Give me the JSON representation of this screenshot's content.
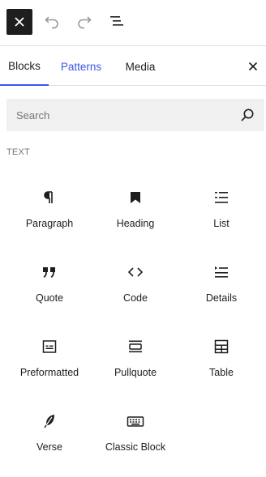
{
  "toolbar": {
    "close_icon": "close-icon",
    "undo_icon": "undo-icon",
    "redo_icon": "redo-icon",
    "outline_icon": "document-overview-icon"
  },
  "tabs": {
    "items": [
      {
        "label": "Blocks"
      },
      {
        "label": "Patterns"
      },
      {
        "label": "Media"
      }
    ],
    "active": "Blocks",
    "accent_color": "#3858e9"
  },
  "search": {
    "placeholder": "Search",
    "value": ""
  },
  "section": {
    "title": "TEXT"
  },
  "blocks": [
    {
      "label": "Paragraph",
      "icon": "paragraph-icon"
    },
    {
      "label": "Heading",
      "icon": "heading-bookmark-icon"
    },
    {
      "label": "List",
      "icon": "list-icon"
    },
    {
      "label": "Quote",
      "icon": "quote-icon"
    },
    {
      "label": "Code",
      "icon": "code-icon"
    },
    {
      "label": "Details",
      "icon": "details-icon"
    },
    {
      "label": "Preformatted",
      "icon": "preformatted-icon"
    },
    {
      "label": "Pullquote",
      "icon": "pullquote-icon"
    },
    {
      "label": "Table",
      "icon": "table-icon"
    },
    {
      "label": "Verse",
      "icon": "verse-feather-icon"
    },
    {
      "label": "Classic Block",
      "icon": "keyboard-icon"
    }
  ]
}
